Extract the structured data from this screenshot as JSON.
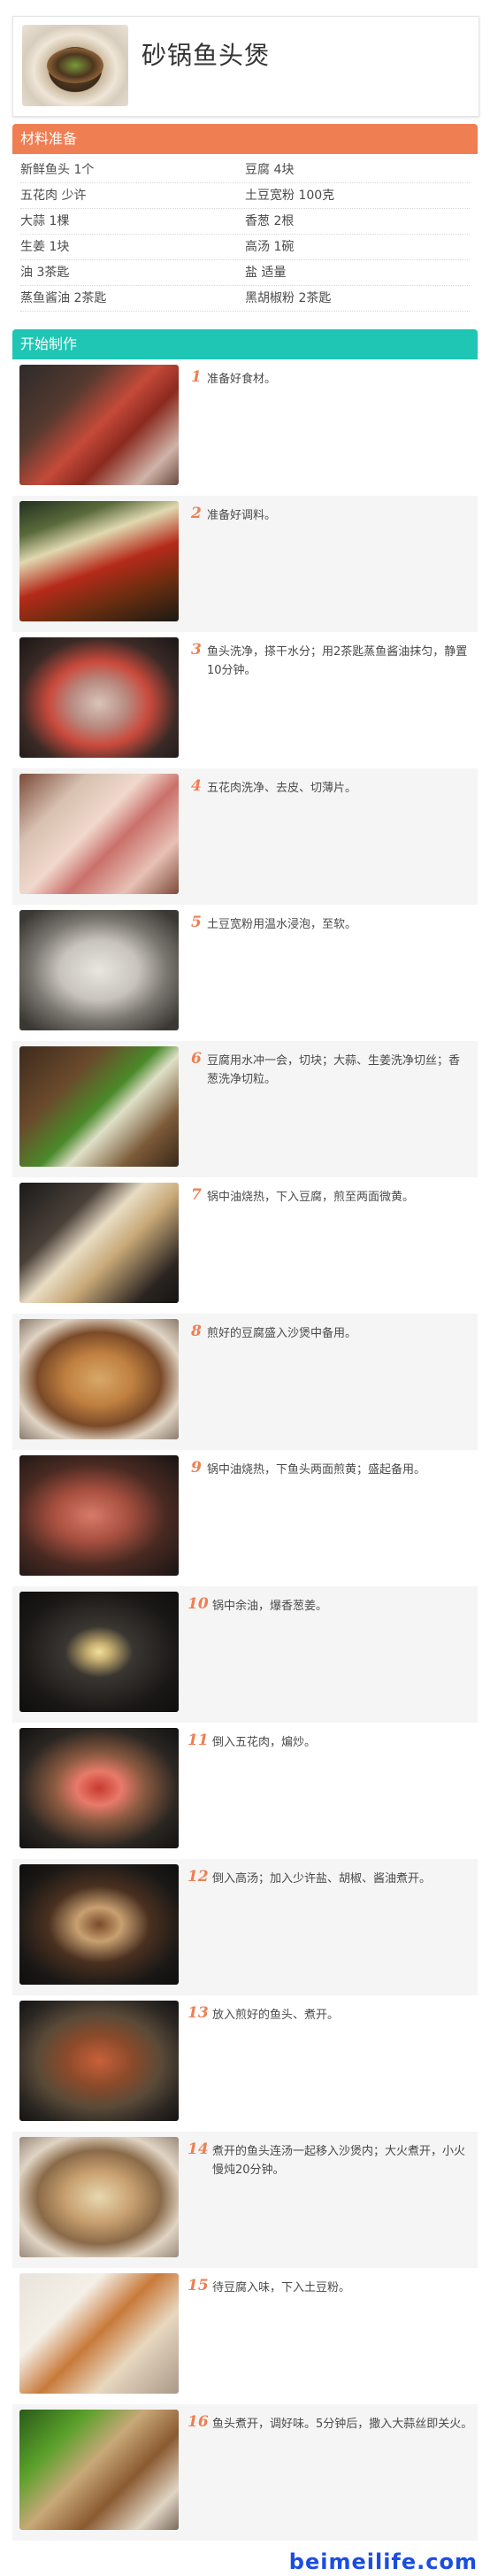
{
  "header": {
    "title": "砂锅鱼头煲"
  },
  "ingredients": {
    "title": "材料准备",
    "rows": [
      [
        "新鲜鱼头 1个",
        "豆腐 4块"
      ],
      [
        "五花肉 少许",
        "土豆宽粉 100克"
      ],
      [
        "大蒜 1棵",
        "香葱 2根"
      ],
      [
        "生姜 1块",
        "高汤 1碗"
      ],
      [
        "油 3茶匙",
        "盐 适量"
      ],
      [
        "蒸鱼酱油 2茶匙",
        "黑胡椒粉 2茶匙"
      ]
    ]
  },
  "steps_section": {
    "title": "开始制作",
    "steps": [
      {
        "num": "1",
        "text": "准备好食材。"
      },
      {
        "num": "2",
        "text": "准备好调料。"
      },
      {
        "num": "3",
        "text": "鱼头洗净，搽干水分；用2茶匙蒸鱼酱油抹匀，静置10分钟。"
      },
      {
        "num": "4",
        "text": "五花肉洗净、去皮、切薄片。"
      },
      {
        "num": "5",
        "text": "土豆宽粉用温水浸泡，至软。"
      },
      {
        "num": "6",
        "text": "豆腐用水冲一会，切块；大蒜、生姜洗净切丝；香葱洗净切粒。"
      },
      {
        "num": "7",
        "text": "锅中油烧热，下入豆腐，煎至两面微黄。"
      },
      {
        "num": "8",
        "text": "煎好的豆腐盛入沙煲中备用。"
      },
      {
        "num": "9",
        "text": "锅中油烧热，下鱼头两面煎黄；盛起备用。"
      },
      {
        "num": "10",
        "text": "锅中余油，爆香葱姜。"
      },
      {
        "num": "11",
        "text": "倒入五花肉，煸炒。"
      },
      {
        "num": "12",
        "text": "倒入高汤；加入少许盐、胡椒、酱油煮开。"
      },
      {
        "num": "13",
        "text": "放入煎好的鱼头、煮开。"
      },
      {
        "num": "14",
        "text": "煮开的鱼头连汤一起移入沙煲内；大火煮开，小火慢炖20分钟。"
      },
      {
        "num": "15",
        "text": "待豆腐入味，下入土豆粉。"
      },
      {
        "num": "16",
        "text": "鱼头煮开，调好味。5分钟后，撒入大蒜丝即关火。"
      }
    ]
  },
  "watermark": "beimeilife.com"
}
